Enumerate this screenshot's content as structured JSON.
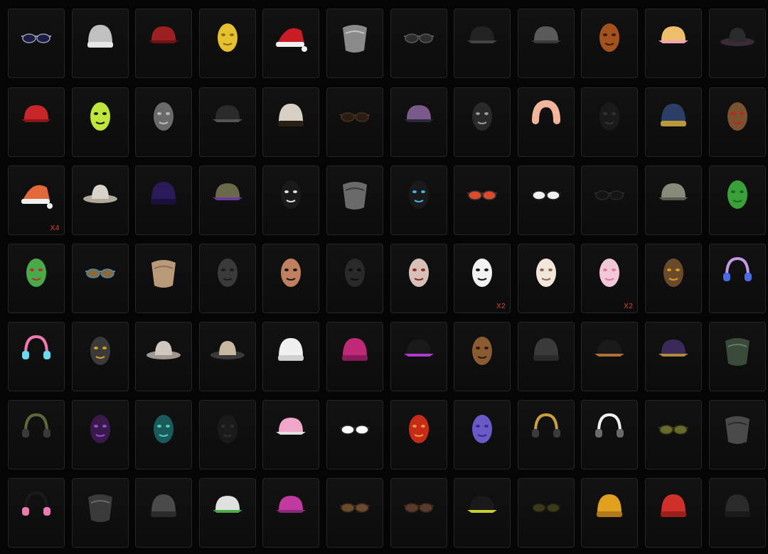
{
  "inventory": {
    "rows": [
      [
        {
          "icon": "goggles-icon",
          "colors": [
            "#1c1c44",
            "#9a9ab0"
          ]
        },
        {
          "icon": "beanie-pompom-icon",
          "colors": [
            "#c0c0c0",
            "#e6e6e6"
          ]
        },
        {
          "icon": "beret-icon",
          "colors": [
            "#9c1f22",
            "#6e1216"
          ]
        },
        {
          "icon": "yellow-mask-icon",
          "colors": [
            "#e5c02f",
            "#8a6f10"
          ]
        },
        {
          "icon": "santa-hat-icon",
          "colors": [
            "#c81d24",
            "#f0f0f0"
          ]
        },
        {
          "icon": "scarf-icon",
          "colors": [
            "#8a8a8a",
            "#c4c4c4"
          ]
        },
        {
          "icon": "sunglasses-icon",
          "colors": [
            "#2e2e2e",
            "#5a5a5a"
          ]
        },
        {
          "icon": "military-cap-icon",
          "colors": [
            "#222222",
            "#444444"
          ]
        },
        {
          "icon": "baseball-cap-icon",
          "colors": [
            "#5a5a5a",
            "#3a3a3a"
          ]
        },
        {
          "icon": "pumpkin-mask-icon",
          "colors": [
            "#a3521e",
            "#3a1a08"
          ]
        },
        {
          "icon": "ice-cream-hat-icon",
          "colors": [
            "#eebf6a",
            "#f0a6b4"
          ]
        },
        {
          "icon": "fedora-icon",
          "colors": [
            "#2b2b2b",
            "#3a2a3a"
          ]
        }
      ],
      [
        {
          "icon": "red-cap-icon",
          "colors": [
            "#c8262a",
            "#8a1515"
          ]
        },
        {
          "icon": "balaclava-icon",
          "colors": [
            "#bfe63a",
            "#1a1a1a"
          ]
        },
        {
          "icon": "gas-mask-icon",
          "colors": [
            "#6a6a6a",
            "#bbbbbb"
          ]
        },
        {
          "icon": "officer-cap-icon",
          "colors": [
            "#2a2a2a",
            "#555555"
          ]
        },
        {
          "icon": "shower-cap-icon",
          "colors": [
            "#d8d0c4",
            "#2a2018"
          ]
        },
        {
          "icon": "glasses-icon",
          "colors": [
            "#2a1c10",
            "#4a3020"
          ]
        },
        {
          "icon": "respirator-icon",
          "colors": [
            "#7a5a8a",
            "#2a2a3a"
          ]
        },
        {
          "icon": "face-mask-icon",
          "colors": [
            "#2a2a2a",
            "#9a9a9a"
          ]
        },
        {
          "icon": "neck-pillow-icon",
          "colors": [
            "#f2b49a",
            "#d89078"
          ]
        },
        {
          "icon": "black-mask-icon",
          "colors": [
            "#1a1a1a",
            "#333333"
          ]
        },
        {
          "icon": "knit-cap-icon",
          "colors": [
            "#2b3e66",
            "#b89a3a"
          ]
        },
        {
          "icon": "reindeer-mask-icon",
          "colors": [
            "#7a5230",
            "#c82020"
          ]
        }
      ],
      [
        {
          "icon": "christmas-hat-icon",
          "colors": [
            "#e26a3a",
            "#f0f0f0"
          ]
        },
        {
          "icon": "straw-hat-icon",
          "colors": [
            "#d8d2c8",
            "#b0a898"
          ]
        },
        {
          "icon": "purple-beanie-icon",
          "colors": [
            "#2a1a5a",
            "#1a103a"
          ]
        },
        {
          "icon": "pith-helmet-icon",
          "colors": [
            "#6a6a4a",
            "#6a3aa0"
          ]
        },
        {
          "icon": "cat-mask-icon",
          "colors": [
            "#1a1a1a",
            "#e0e0e0"
          ]
        },
        {
          "icon": "bandana-icon",
          "colors": [
            "#6a6a6a",
            "#3a3a3a"
          ]
        },
        {
          "icon": "cyber-mask-icon",
          "colors": [
            "#1a1a1a",
            "#4ab0e8"
          ]
        },
        {
          "icon": "round-glasses-icon",
          "colors": [
            "#e04a2a",
            "#3a3a3a"
          ]
        },
        {
          "icon": "white-sunglasses-icon",
          "colors": [
            "#f0f0f0",
            "#222222"
          ]
        },
        {
          "icon": "black-sunglasses-icon",
          "colors": [
            "#141414",
            "#2a2a2a"
          ]
        },
        {
          "icon": "grey-cap-icon",
          "colors": [
            "#8a8a7a",
            "#5a5a50"
          ]
        },
        {
          "icon": "dino-mask-icon",
          "colors": [
            "#3aa03a",
            "#1a6a1a"
          ]
        }
      ],
      [
        {
          "icon": "dino-head-icon",
          "colors": [
            "#4aaa4a",
            "#b03030"
          ]
        },
        {
          "icon": "steampunk-goggles-icon",
          "colors": [
            "#8a6a3a",
            "#4a8ab0"
          ]
        },
        {
          "icon": "tan-scarf-icon",
          "colors": [
            "#b89a78",
            "#8a7054"
          ]
        },
        {
          "icon": "tactical-mask-icon",
          "colors": [
            "#3a3a3a",
            "#1a1a1a"
          ]
        },
        {
          "icon": "face-paint-icon",
          "colors": [
            "#c08060",
            "#1a1a1a"
          ]
        },
        {
          "icon": "horned-mask-icon",
          "colors": [
            "#2a2a2a",
            "#0e0e0e"
          ]
        },
        {
          "icon": "smile-mask-icon",
          "colors": [
            "#d8c0b8",
            "#8a2a2a"
          ]
        },
        {
          "icon": "white-mask-icon",
          "colors": [
            "#f2f2f2",
            "#1a1a1a"
          ]
        },
        {
          "icon": "sheep-mask-icon",
          "colors": [
            "#f0e6da",
            "#8a6a5a"
          ]
        },
        {
          "icon": "pink-mask-icon",
          "colors": [
            "#f2c8d8",
            "#e07aa0"
          ]
        },
        {
          "icon": "ram-mask-icon",
          "colors": [
            "#6a4a2a",
            "#d8a020"
          ]
        },
        {
          "icon": "headphones-icon",
          "colors": [
            "#c49ae6",
            "#4a6ae6"
          ]
        }
      ],
      [
        {
          "icon": "bow-headband-icon",
          "colors": [
            "#f27ab0",
            "#6adaf0"
          ]
        },
        {
          "icon": "robot-mask-icon",
          "colors": [
            "#3a3a3a",
            "#d8a020"
          ]
        },
        {
          "icon": "cowboy-hat-icon",
          "colors": [
            "#d0c8c0",
            "#a09890"
          ]
        },
        {
          "icon": "cowboy-skull-hat-icon",
          "colors": [
            "#c8b8a0",
            "#3a3a3a"
          ]
        },
        {
          "icon": "bear-ears-beanie-icon",
          "colors": [
            "#f0f0f0",
            "#d0d0d0"
          ]
        },
        {
          "icon": "magenta-beanie-icon",
          "colors": [
            "#c02878",
            "#8a1a5a"
          ]
        },
        {
          "icon": "black-cap-purple-icon",
          "colors": [
            "#1a1a1a",
            "#b03ad0"
          ]
        },
        {
          "icon": "monkey-mask-icon",
          "colors": [
            "#8a5a30",
            "#2a1a10"
          ]
        },
        {
          "icon": "cat-ear-beanie-icon",
          "colors": [
            "#3a3a3a",
            "#2a2a2a"
          ]
        },
        {
          "icon": "aviator-cap-icon",
          "colors": [
            "#1a1a1a",
            "#b07030"
          ]
        },
        {
          "icon": "purple-officer-cap-icon",
          "colors": [
            "#3a2a5a",
            "#b08a3a"
          ]
        },
        {
          "icon": "camo-bandana-icon",
          "colors": [
            "#3a4a3a",
            "#6a7a6a"
          ]
        }
      ],
      [
        {
          "icon": "headset-cap-icon",
          "colors": [
            "#5a6a3a",
            "#3a3a3a"
          ]
        },
        {
          "icon": "purple-balaclava-icon",
          "colors": [
            "#3a1a4a",
            "#9a4ae0"
          ]
        },
        {
          "icon": "teal-mask-icon",
          "colors": [
            "#1a5a5a",
            "#4ad0c0"
          ]
        },
        {
          "icon": "bunny-mask-icon",
          "colors": [
            "#1a1a1a",
            "#2e2e2e"
          ]
        },
        {
          "icon": "bunny-ear-hat-icon",
          "colors": [
            "#f0a6c8",
            "#e0e0e0"
          ]
        },
        {
          "icon": "white-visor-glasses-icon",
          "colors": [
            "#ffffff",
            "#2a2a2a"
          ]
        },
        {
          "icon": "oni-mask-icon",
          "colors": [
            "#c82a1a",
            "#e0a030"
          ]
        },
        {
          "icon": "purple-bunny-mask-icon",
          "colors": [
            "#6a5ac8",
            "#3a2a8a"
          ]
        },
        {
          "icon": "gold-cap-headphones-icon",
          "colors": [
            "#c8a040",
            "#3a3a3a"
          ]
        },
        {
          "icon": "headset-mic-icon",
          "colors": [
            "#f0f0f0",
            "#6a6a6a"
          ]
        },
        {
          "icon": "square-glasses-icon",
          "colors": [
            "#6a6a2a",
            "#3a3a1a"
          ]
        },
        {
          "icon": "grey-bandana-icon",
          "colors": [
            "#4a4a4a",
            "#2a2a2a"
          ]
        }
      ],
      [
        {
          "icon": "bunny-headband-icon",
          "colors": [
            "#1a1a1a",
            "#f07ab0"
          ]
        },
        {
          "icon": "paisley-bandana-icon",
          "colors": [
            "#3a3a3a",
            "#6a6a6a"
          ]
        },
        {
          "icon": "grey-beanie-icon",
          "colors": [
            "#4a4a4a",
            "#2a2a2a"
          ]
        },
        {
          "icon": "drink-helmet-icon",
          "colors": [
            "#e0e0e0",
            "#4aaa4a"
          ]
        },
        {
          "icon": "pink-visor-icon",
          "colors": [
            "#c03aa0",
            "#8a2a7a"
          ]
        },
        {
          "icon": "aviator-sunglasses-icon",
          "colors": [
            "#6a4a2a",
            "#3a2a1a"
          ]
        },
        {
          "icon": "brown-aviators-icon",
          "colors": [
            "#5a3a2a",
            "#3a2a1a"
          ]
        },
        {
          "icon": "black-cap-yellow-icon",
          "colors": [
            "#1a1a1a",
            "#c8d030"
          ]
        },
        {
          "icon": "thin-glasses-icon",
          "colors": [
            "#3a3a1a",
            "#1a1a0a"
          ]
        },
        {
          "icon": "yellow-beanie-icon",
          "colors": [
            "#e0a020",
            "#b07818"
          ]
        },
        {
          "icon": "red-beanie-icon",
          "colors": [
            "#d0302a",
            "#9a1e1a"
          ]
        },
        {
          "icon": "black-beanie-icon",
          "colors": [
            "#2a2a2a",
            "#1a1a1a"
          ]
        }
      ]
    ],
    "counts": {
      "2-0": "X4",
      "3-7": "X2",
      "3-9": "X2"
    }
  }
}
